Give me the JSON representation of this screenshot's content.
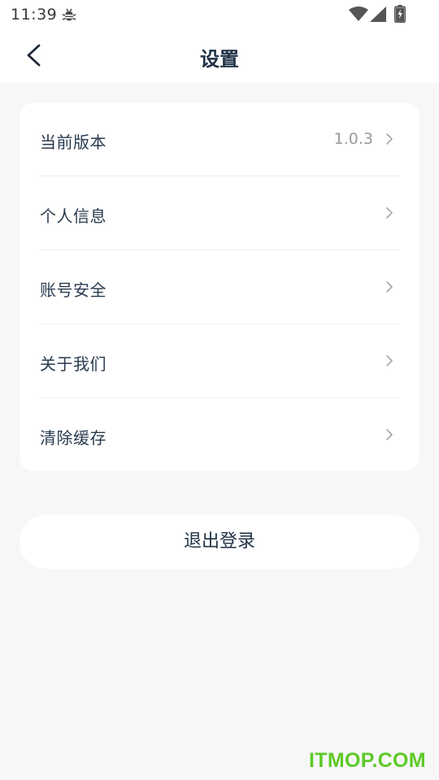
{
  "status_bar": {
    "time": "11:39",
    "icons": [
      "bug-icon",
      "wifi-icon",
      "signal-icon",
      "battery-charging-icon"
    ]
  },
  "nav": {
    "back_icon": "chevron-left-icon",
    "title": "设置"
  },
  "settings": {
    "items": [
      {
        "label": "当前版本",
        "value": "1.0.3"
      },
      {
        "label": "个人信息",
        "value": ""
      },
      {
        "label": "账号安全",
        "value": ""
      },
      {
        "label": "关于我们",
        "value": ""
      },
      {
        "label": "清除缓存",
        "value": ""
      }
    ],
    "chevron_icon": "chevron-right-icon"
  },
  "logout": {
    "label": "退出登录"
  },
  "watermark": {
    "text": "ITMOP.COM",
    "color": "#5ec928"
  },
  "colors": {
    "title": "#1f3145",
    "label": "#2a3b4f",
    "value": "#9a9a9a",
    "background": "#f7f7f8",
    "card": "#ffffff"
  }
}
